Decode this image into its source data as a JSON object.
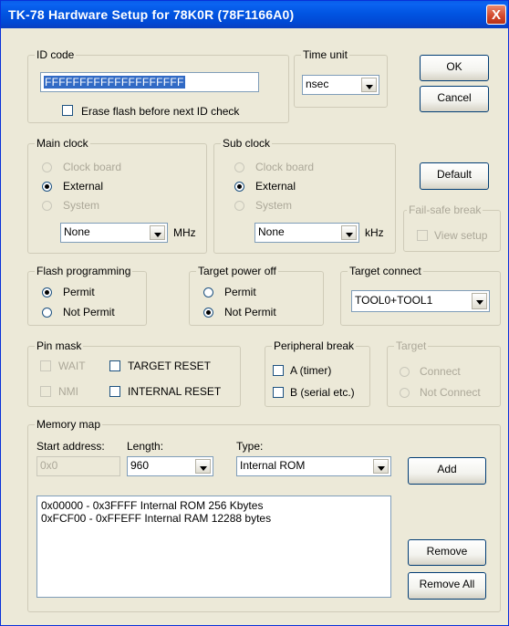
{
  "window": {
    "title": "TK-78 Hardware Setup for 78K0R  (78F1166A0)",
    "close_glyph": "X"
  },
  "buttons": {
    "ok": "OK",
    "cancel": "Cancel",
    "default": "Default",
    "add": "Add",
    "remove": "Remove",
    "remove_all": "Remove All"
  },
  "id_code": {
    "legend": "ID code",
    "value": "FFFFFFFFFFFFFFFFFFFF",
    "erase_label": "Erase flash before next ID check"
  },
  "time_unit": {
    "legend": "Time unit",
    "value": "nsec"
  },
  "main_clock": {
    "legend": "Main clock",
    "options": [
      "Clock board",
      "External",
      "System"
    ],
    "selected": "External",
    "value": "None",
    "unit": "MHz"
  },
  "sub_clock": {
    "legend": "Sub clock",
    "options": [
      "Clock board",
      "External",
      "System"
    ],
    "selected": "External",
    "value": "None",
    "unit": "kHz"
  },
  "fail_safe": {
    "legend": "Fail-safe break",
    "view_label": "View setup"
  },
  "flash_programming": {
    "legend": "Flash programming",
    "options": [
      "Permit",
      "Not Permit"
    ],
    "selected": "Permit"
  },
  "target_power_off": {
    "legend": "Target power off",
    "options": [
      "Permit",
      "Not Permit"
    ],
    "selected": "Not Permit"
  },
  "target_connect": {
    "legend": "Target connect",
    "value": "TOOL0+TOOL1"
  },
  "pin_mask": {
    "legend": "Pin mask",
    "wait": "WAIT",
    "nmi": "NMI",
    "target_reset": "TARGET RESET",
    "internal_reset": "INTERNAL RESET"
  },
  "peripheral_break": {
    "legend": "Peripheral break",
    "a": "A (timer)",
    "b": "B (serial etc.)"
  },
  "target": {
    "legend": "Target",
    "options": [
      "Connect",
      "Not Connect"
    ]
  },
  "memory_map": {
    "legend": "Memory map",
    "start_label": "Start address:",
    "start_value": "0x0",
    "length_label": "Length:",
    "length_value": "960",
    "type_label": "Type:",
    "type_value": "Internal ROM",
    "entries": [
      "0x00000 - 0x3FFFF Internal ROM  256  Kbytes",
      "0xFCF00 - 0xFFEFF Internal RAM  12288  bytes"
    ]
  }
}
